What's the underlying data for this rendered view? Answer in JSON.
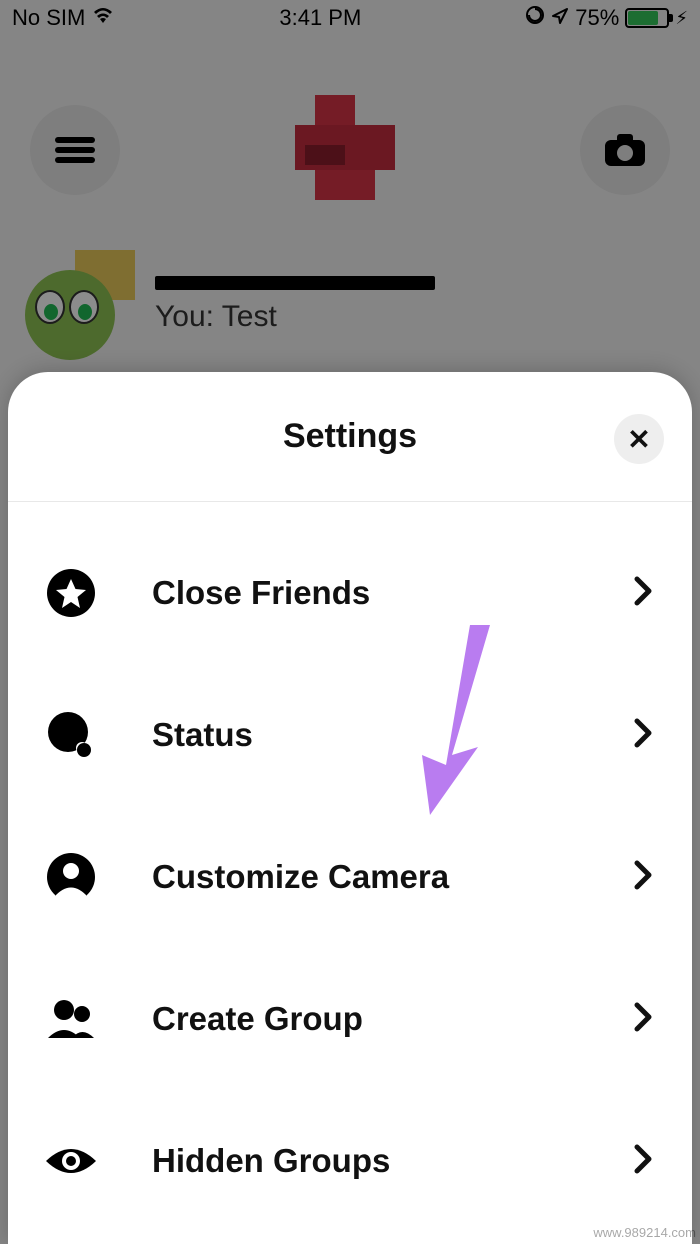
{
  "status": {
    "sim": "No SIM",
    "time": "3:41 PM",
    "battery_pct": "75%"
  },
  "chat": {
    "message": "You: Test"
  },
  "sheet": {
    "title": "Settings",
    "items": [
      {
        "icon": "star-icon",
        "label": "Close Friends"
      },
      {
        "icon": "status-icon",
        "label": "Status"
      },
      {
        "icon": "person-icon",
        "label": "Customize Camera"
      },
      {
        "icon": "group-icon",
        "label": "Create Group"
      },
      {
        "icon": "eye-icon",
        "label": "Hidden Groups"
      }
    ]
  },
  "annotation": {
    "arrow_color": "#b97cf0"
  },
  "watermark": "www.989214.com"
}
